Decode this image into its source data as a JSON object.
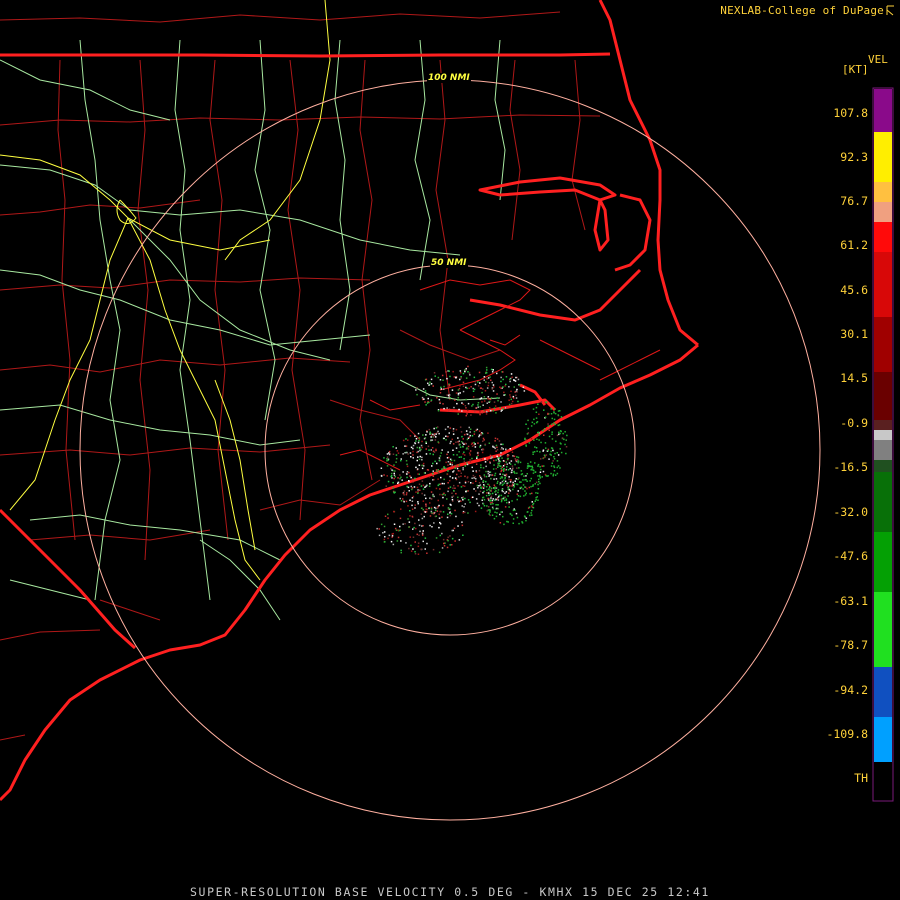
{
  "credit": "NEXLAB-College of DuPage",
  "caption": "SUPER-RESOLUTION BASE VELOCITY 0.5 DEG - KMHX 15 DEC 25 12:41",
  "legend": {
    "product": "VEL",
    "units": "[KT]",
    "ticks": [
      "107.8",
      "92.3",
      "76.7",
      "61.2",
      "45.6",
      "30.1",
      "14.5",
      "-0.9",
      "-16.5",
      "-32.0",
      "-47.6",
      "-63.1",
      "-78.7",
      "-94.2",
      "-109.8",
      "TH"
    ]
  },
  "rings": {
    "inner_label": "50 NMI",
    "outer_label": "100 NMI"
  },
  "colors": {
    "background": "#000000",
    "state_border": "#ff2020",
    "county_line": "#c01818",
    "highway_major": "#ffff40",
    "highway_minor": "#a8e8a0",
    "range_ring": "#ffb0a0",
    "legend_text": "#ffd23a"
  }
}
